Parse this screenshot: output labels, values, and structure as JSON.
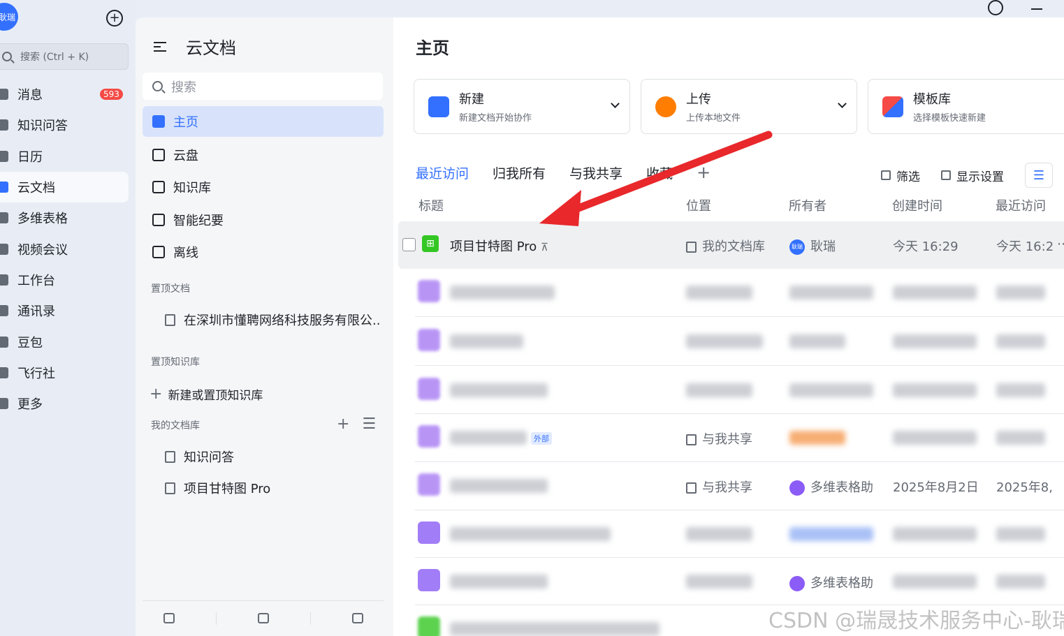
{
  "rail": {
    "avatar_text": "耿瑞",
    "search_placeholder": "搜索 (Ctrl + K)",
    "items": [
      {
        "label": "消息",
        "badge": "593"
      },
      {
        "label": "知识问答"
      },
      {
        "label": "日历"
      },
      {
        "label": "云文档",
        "active": true
      },
      {
        "label": "多维表格"
      },
      {
        "label": "视频会议"
      },
      {
        "label": "工作台"
      },
      {
        "label": "通讯录"
      },
      {
        "label": "豆包"
      },
      {
        "label": "飞行社"
      },
      {
        "label": "更多"
      }
    ]
  },
  "sidebar": {
    "title": "云文档",
    "search_placeholder": "搜索",
    "nav": [
      {
        "label": "主页",
        "active": true
      },
      {
        "label": "云盘"
      },
      {
        "label": "知识库"
      },
      {
        "label": "智能纪要"
      },
      {
        "label": "离线"
      }
    ],
    "pinned_docs_label": "置顶文档",
    "pinned_doc": "在深圳市懂聘网络科技服务有限公...",
    "pinned_kb_label": "置顶知识库",
    "add_kb_label": "新建或置顶知识库",
    "my_library_label": "我的文档库",
    "library_items": [
      "知识问答",
      "项目甘特图 Pro"
    ]
  },
  "main": {
    "title": "主页",
    "cards": [
      {
        "title": "新建",
        "subtitle": "新建文档开始协作",
        "color": "#3370ff"
      },
      {
        "title": "上传",
        "subtitle": "上传本地文件",
        "color": "#ff7d00"
      },
      {
        "title": "模板库",
        "subtitle": "选择模板快速新建",
        "color": "#f54a45"
      }
    ],
    "tabs": [
      "最近访问",
      "归我所有",
      "与我共享",
      "收藏"
    ],
    "filter_label": "筛选",
    "display_settings_label": "显示设置",
    "columns": {
      "title": "标题",
      "location": "位置",
      "owner": "所有者",
      "created": "创建时间",
      "visited": "最近访问"
    },
    "first_row": {
      "title": "项目甘特图 Pro",
      "location": "我的文档库",
      "owner": "耿瑞",
      "owner_avatar": "耿瑞",
      "created": "今天 16:29",
      "visited": "今天 16:2"
    },
    "partial_texts": {
      "row4_location": "与我共享",
      "row4_tag": "外部",
      "row5_location": "与我共享",
      "row5_owner": "多维表格助",
      "row5_created": "2025年8月2日",
      "row5_visited": "2025年8,",
      "row7_owner": "多维表格助"
    }
  },
  "watermark": "CSDN @瑞晟技术服务中心-耿瑞"
}
